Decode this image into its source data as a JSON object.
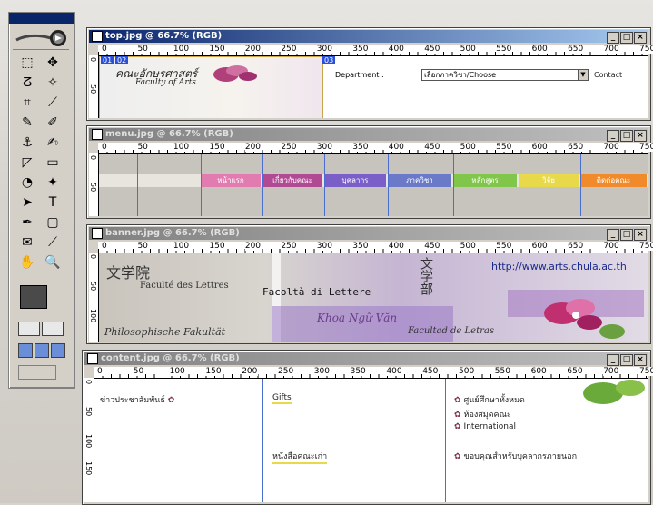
{
  "colors": {
    "title_active": "#0a246a",
    "menu": [
      "#e27bb0",
      "#b04a93",
      "#7a5fc8",
      "#6a7ac8",
      "#7fc64a",
      "#e8d94a",
      "#f08a2a"
    ]
  },
  "toolbox": {
    "tools": [
      "marquee-icon",
      "move-icon",
      "lasso-icon",
      "magic-wand-icon",
      "crop-icon",
      "slice-icon",
      "healing-brush-icon",
      "brush-icon",
      "clone-stamp-icon",
      "history-brush-icon",
      "eraser-icon",
      "gradient-icon",
      "blur-icon",
      "dodge-icon",
      "path-select-icon",
      "type-icon",
      "pen-icon",
      "shape-icon",
      "notes-icon",
      "eyedropper-icon",
      "hand-icon",
      "zoom-icon"
    ],
    "tool_glyphs": [
      "⬚",
      "✥",
      "ⵒ",
      "✧",
      "⌗",
      "⟋",
      "✎",
      "✐",
      "⚓",
      "✍",
      "◸",
      "▭",
      "◔",
      "✦",
      "➤",
      "T",
      "✒",
      "▢",
      "✉",
      "⟋",
      "✋",
      "🔍"
    ]
  },
  "ruler_labels": [
    "0",
    "50",
    "100",
    "150",
    "200",
    "250",
    "300",
    "350",
    "400",
    "450",
    "500",
    "550",
    "600",
    "650",
    "700",
    "750"
  ],
  "windows": [
    {
      "title": "top.jpg @ 66.7% (RGB)",
      "state": "active"
    },
    {
      "title": "menu.jpg @ 66.7% (RGB)",
      "state": "inactive"
    },
    {
      "title": "banner.jpg @ 66.7% (RGB)",
      "state": "inactive"
    },
    {
      "title": "content.jpg @ 66.7% (RGB)",
      "state": "inactive"
    }
  ],
  "top": {
    "slice_tags": [
      "01",
      "02",
      "03"
    ],
    "logo_line1": "คณะอักษรศาสตร์",
    "logo_line2": "Faculty of Arts",
    "dept_label": "Department :",
    "dept_value": "เลือกภาควิชา/Choose",
    "right_label": "Contact"
  },
  "menu": {
    "items": [
      "หน้าแรก",
      "เกี่ยวกับคณะ",
      "บุคลากร",
      "ภาควิชา",
      "หลักสูตร",
      "วิจัย",
      "ติดต่อคณะ"
    ]
  },
  "banner": {
    "url": "http://www.arts.chula.ac.th",
    "texts": [
      "文学院",
      "Faculté des Lettres",
      "Facoltà di Lettere",
      "Khoa Ngữ Văn",
      "Philosophische Fakultät",
      "Facultad de Letras"
    ],
    "cjk": "文学部"
  },
  "content": {
    "left_title": "ข่าวประชาสัมพันธ์",
    "mid_top": "Gifts",
    "mid_bottom": "หนังสือคณะเก่า",
    "right_items": [
      "ศูนย์ศึกษาทั้งหมด",
      "ห้องสมุดคณะ",
      "International",
      "ขอบคุณสำหรับบุคลากรภายนอก"
    ]
  }
}
